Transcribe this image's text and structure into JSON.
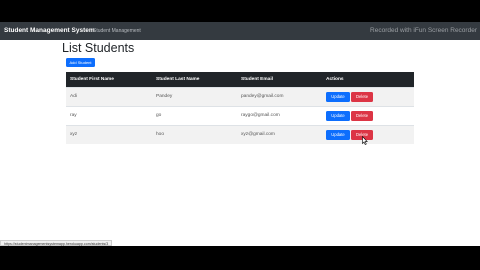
{
  "navbar": {
    "brand": "Student Management System",
    "link": "Student Management",
    "watermark": "Recorded with iFun Screen Recorder"
  },
  "page": {
    "title": "List Students",
    "add_button": "Add Student"
  },
  "table": {
    "headers": [
      "Student First Name",
      "Student Last Name",
      "Student Email",
      "Actions"
    ],
    "rows": [
      {
        "first": "Adi",
        "last": "Pandey",
        "email": "pandey@gmail.com"
      },
      {
        "first": "ray",
        "last": "go",
        "email": "raygo@gmail.com"
      },
      {
        "first": "xyz",
        "last": "hoo",
        "email": "xyz@gmail.com"
      }
    ],
    "update_label": "Update",
    "delete_label": "Delete"
  },
  "status": {
    "url": "https://studentmanagementsystemapp.herokuapp.com/students/3"
  },
  "colors": {
    "navbar": "#343a40",
    "primary": "#0d6efd",
    "danger": "#dc3545",
    "table_header": "#212529"
  }
}
